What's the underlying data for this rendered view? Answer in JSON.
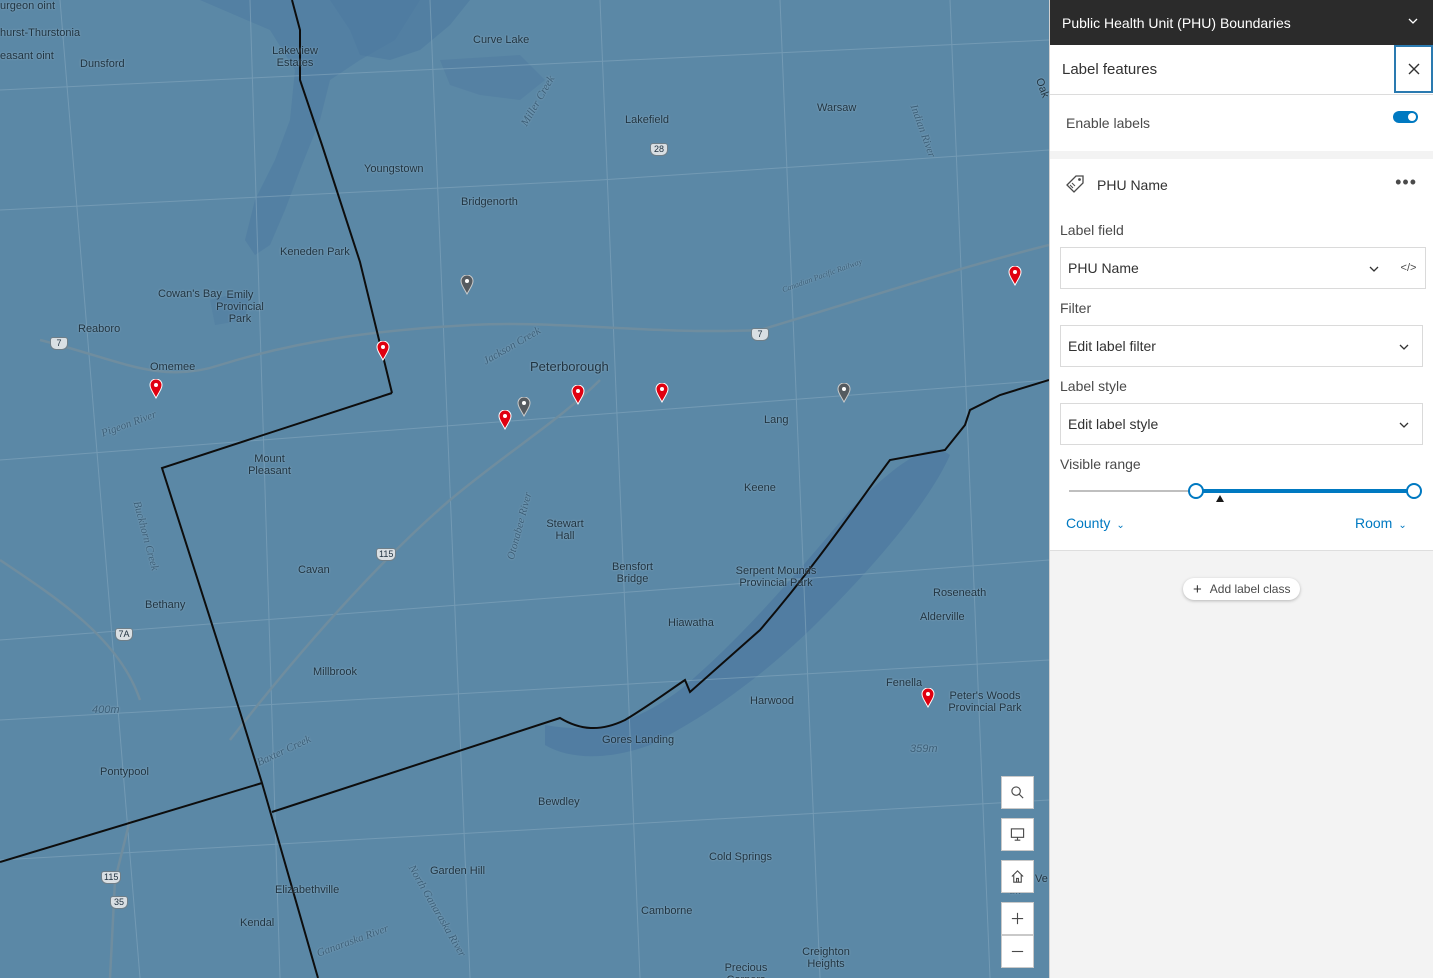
{
  "panel": {
    "layer_title": "Public Health Unit (PHU) Boundaries",
    "section_title": "Label features",
    "enable_labels_label": "Enable labels",
    "enable_labels_on": true,
    "label_class": {
      "name": "PHU Name",
      "label_field_label": "Label field",
      "label_field_value": "PHU Name",
      "expression_button": "</>",
      "filter_label": "Filter",
      "filter_value": "Edit label filter",
      "style_label": "Label style",
      "style_value": "Edit label style",
      "visible_range_label": "Visible range",
      "range_min": "County",
      "range_max": "Room",
      "range_min_fraction": 0.37,
      "range_max_fraction": 1.0
    },
    "add_label_class": "Add label class"
  },
  "map": {
    "places": [
      "Curve Lake",
      "Lakeview Estates",
      "Lakefield",
      "Warsaw",
      "Dunsford",
      "Youngstown",
      "Bridgenorth",
      "Keneden Park",
      "Cowan's Bay",
      "Emily Provincial Park",
      "Reaboro",
      "Omemee",
      "Peterborough",
      "Lang",
      "Mount Pleasant",
      "Keene",
      "Stewart Hall",
      "Cavan",
      "Bensfort Bridge",
      "Serpent Mounds Provincial Park",
      "Bethany",
      "Hiawatha",
      "Roseneath",
      "Alderville",
      "Millbrook",
      "Fenella",
      "Peter's Woods Provincial Park",
      "Harwood",
      "Gores Landing",
      "Pontypool",
      "Bewdley",
      "Cold Springs",
      "Garden Hill",
      "Elizabethville",
      "Camborne",
      "Kendal",
      "Creighton Heights",
      "Precious Corners",
      "urgeon oint",
      "hurst-Thurstonia",
      "easant oint"
    ],
    "water_labels": [
      "Miller Creek",
      "Pigeon River",
      "Jackson Creek",
      "Otonabee River",
      "Baxter Creek",
      "North Ganaraska River",
      "Ganaraska River",
      "Buckhorn Creek",
      "Indian River",
      "Canadian Pacific Railway"
    ],
    "elevations": [
      "400m",
      "359m"
    ],
    "highway_shields": [
      "28",
      "7",
      "7",
      "115",
      "7A",
      "115",
      "35"
    ],
    "partial_labels": [
      "Ve",
      "Sh",
      "Oak"
    ],
    "tools": [
      "search-icon",
      "monitor-icon",
      "home-icon",
      "plus-icon",
      "minus-icon"
    ]
  }
}
